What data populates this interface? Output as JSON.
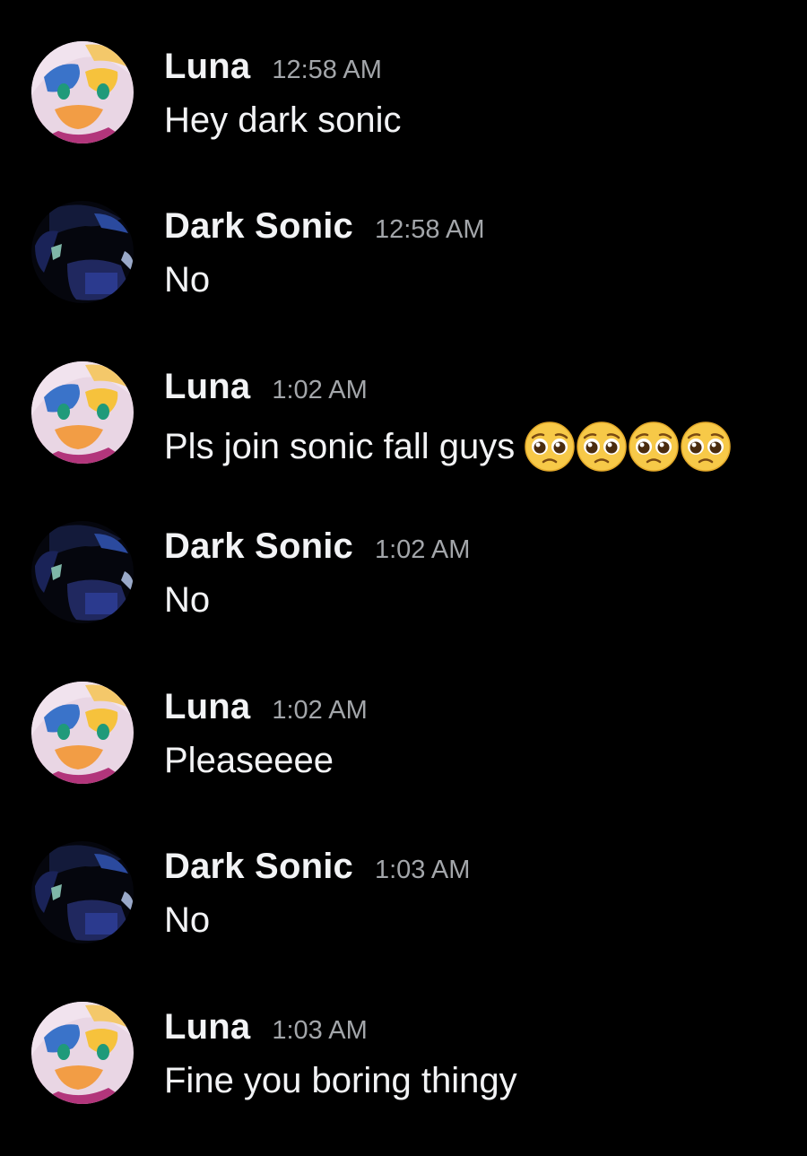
{
  "colors": {
    "background": "#000000",
    "username": "#f2f3f5",
    "timestamp": "#a3a6aa",
    "message_text": "#f2f3f5"
  },
  "messages": [
    {
      "author": "Luna",
      "time": "12:58 AM",
      "text": "Hey dark sonic",
      "avatar": "luna-avatar",
      "emojis": []
    },
    {
      "author": "Dark Sonic",
      "time": "12:58 AM",
      "text": "No",
      "avatar": "dark-sonic-avatar",
      "emojis": []
    },
    {
      "author": "Luna",
      "time": "1:02 AM",
      "text": "Pls join sonic fall guys",
      "avatar": "luna-avatar",
      "emojis": [
        "pleading-face-emoji",
        "pleading-face-emoji",
        "pleading-face-emoji",
        "pleading-face-emoji"
      ]
    },
    {
      "author": "Dark Sonic",
      "time": "1:02 AM",
      "text": "No",
      "avatar": "dark-sonic-avatar",
      "emojis": []
    },
    {
      "author": "Luna",
      "time": "1:02 AM",
      "text": "Pleaseeee",
      "avatar": "luna-avatar",
      "emojis": []
    },
    {
      "author": "Dark Sonic",
      "time": "1:03 AM",
      "text": "No",
      "avatar": "dark-sonic-avatar",
      "emojis": []
    },
    {
      "author": "Luna",
      "time": "1:03 AM",
      "text": "Fine you boring thingy",
      "avatar": "luna-avatar",
      "emojis": []
    }
  ]
}
